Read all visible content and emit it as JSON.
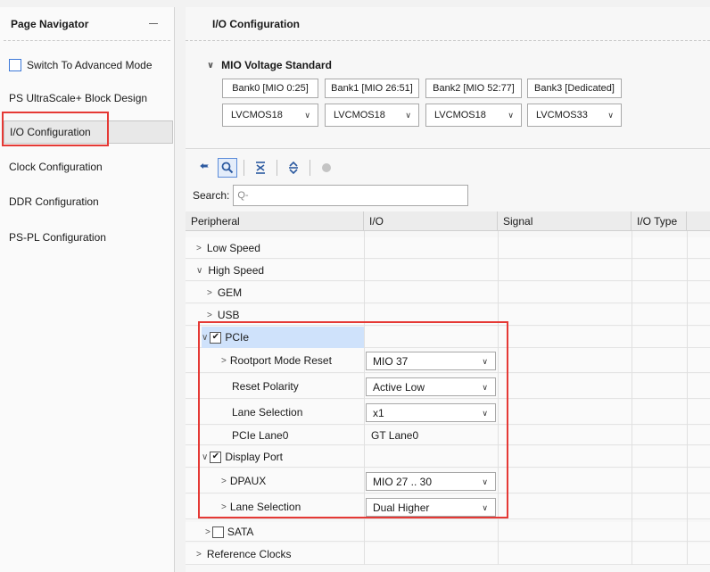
{
  "navigator": {
    "title": "Page Navigator",
    "advanced_mode_label": "Switch To Advanced Mode",
    "items": [
      "PS UltraScale+ Block Design",
      "I/O Configuration",
      "Clock Configuration",
      "DDR Configuration",
      "PS-PL Configuration"
    ]
  },
  "main": {
    "title": "I/O Configuration",
    "mio_section_title": "MIO Voltage Standard",
    "banks": [
      {
        "label": "Bank0 [MIO 0:25]",
        "value": "LVCMOS18"
      },
      {
        "label": "Bank1 [MIO 26:51]",
        "value": "LVCMOS18"
      },
      {
        "label": "Bank2 [MIO 52:77]",
        "value": "LVCMOS18"
      },
      {
        "label": "Bank3 [Dedicated]",
        "value": "LVCMOS33"
      }
    ],
    "search_label": "Search:",
    "search_placeholder": "Q-",
    "columns": [
      "Peripheral",
      "I/O",
      "Signal",
      "I/O Type"
    ],
    "rows": {
      "low_speed": "Low Speed",
      "high_speed": "High Speed",
      "gem": "GEM",
      "usb": "USB",
      "pcie": "PCIe",
      "rootport_mode_reset": "Rootport Mode Reset",
      "rootport_value": "MIO 37",
      "reset_polarity": "Reset Polarity",
      "reset_polarity_value": "Active Low",
      "lane_selection": "Lane Selection",
      "lane_selection_value": "x1",
      "pcie_lane0": "PCIe Lane0",
      "pcie_lane0_value": "GT Lane0",
      "display_port": "Display Port",
      "dpaux": "DPAUX",
      "dpaux_value": "MIO 27 .. 30",
      "dp_lane_selection": "Lane Selection",
      "dp_lane_selection_value": "Dual Higher",
      "sata": "SATA",
      "reference_clocks": "Reference Clocks"
    }
  },
  "colors": {
    "highlight_red": "#e53935",
    "selected_row": "#cfe2fb",
    "accent_blue": "#2c5aa0"
  }
}
